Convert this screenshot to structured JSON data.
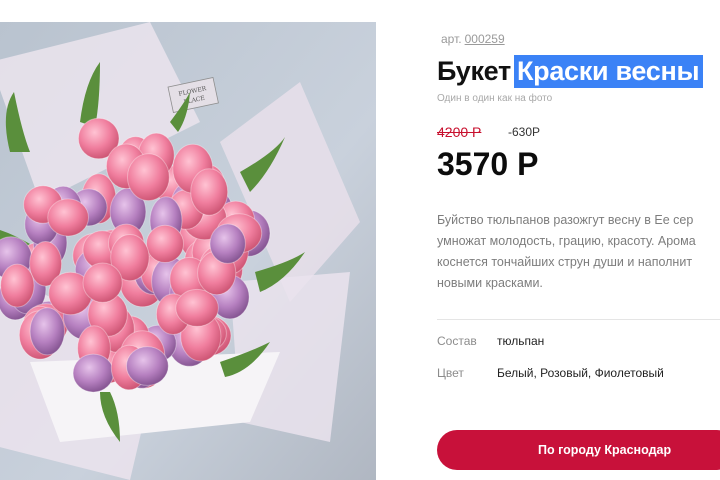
{
  "product": {
    "sku_label": "арт.",
    "sku_value": "000259",
    "title_prefix": "Букет",
    "title_highlight": "Краски весны",
    "subtitle": "Один в один как на фото",
    "old_price": "4200 Р",
    "discount": "-630Р",
    "price": "3570 Р",
    "description_lines": [
      "Буйство тюльпанов разожгут весну в Ее сер",
      "умножат молодость, грацию, красоту. Арома",
      "коснется тончайших струн души и наполнит",
      "новыми красками."
    ],
    "specs": [
      {
        "label": "Состав",
        "value": "тюльпан"
      },
      {
        "label": "Цвет",
        "value": "Белый, Розовый, Фиолетовый"
      }
    ],
    "delivery_button": "По городу Краснодар",
    "image": {
      "logo_lines": [
        "FLOWER",
        "PLACE"
      ],
      "colors": {
        "background": "#c3ccd8",
        "pink": "#f07e9e",
        "lilac": "#b680c0",
        "leaf": "#5a8f3c",
        "wrap": "#ece6ee"
      }
    }
  },
  "colors": {
    "accent": "#c8113a",
    "highlight": "#3b82f6",
    "old_price": "#c8102e"
  }
}
